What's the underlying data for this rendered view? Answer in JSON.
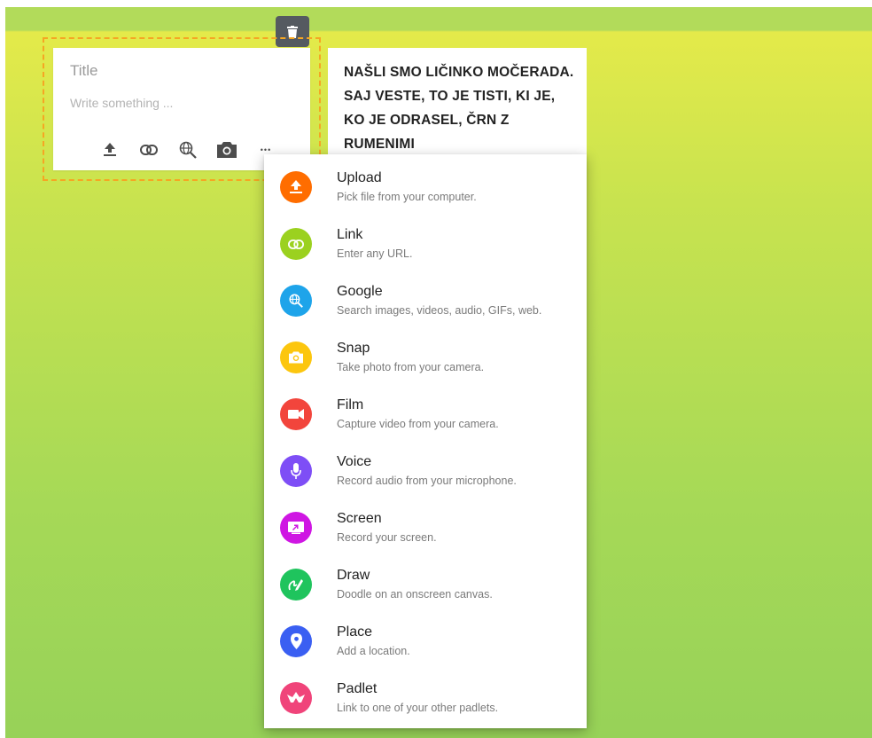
{
  "composer": {
    "title_placeholder": "Title",
    "body_placeholder": "Write something ..."
  },
  "toolbar": {
    "tools": [
      {
        "icon": "upload-icon"
      },
      {
        "icon": "link-icon"
      },
      {
        "icon": "globe-search-icon"
      },
      {
        "icon": "camera-icon"
      },
      {
        "icon": "more-icon",
        "glyph": "•••"
      }
    ]
  },
  "note": {
    "text": "NAŠLI SMO LIČINKO MOČERADA. SAJ VESTE, TO JE TISTI, KI JE, KO JE ODRASEL, ČRN Z RUMENIMI"
  },
  "menu": {
    "items": [
      {
        "label": "Upload",
        "desc": "Pick file from your computer.",
        "color": "#ff6d00",
        "icon": "upload-icon"
      },
      {
        "label": "Link",
        "desc": "Enter any URL.",
        "color": "#9bd11f",
        "icon": "link-icon"
      },
      {
        "label": "Google",
        "desc": "Search images, videos, audio, GIFs, web.",
        "color": "#1ea4ea",
        "icon": "google-search-icon"
      },
      {
        "label": "Snap",
        "desc": "Take photo from your camera.",
        "color": "#fcc60e",
        "icon": "camera-icon"
      },
      {
        "label": "Film",
        "desc": "Capture video from your camera.",
        "color": "#f2453c",
        "icon": "video-camera-icon"
      },
      {
        "label": "Voice",
        "desc": "Record audio from your microphone.",
        "color": "#7e4ef6",
        "icon": "microphone-icon"
      },
      {
        "label": "Screen",
        "desc": "Record your screen.",
        "color": "#cf16e3",
        "icon": "screen-record-icon"
      },
      {
        "label": "Draw",
        "desc": "Doodle on an onscreen canvas.",
        "color": "#1fc45d",
        "icon": "draw-icon"
      },
      {
        "label": "Place",
        "desc": "Add a location.",
        "color": "#3a5ff2",
        "icon": "location-pin-icon"
      },
      {
        "label": "Padlet",
        "desc": "Link to one of your other padlets.",
        "color": "#f0447a",
        "icon": "padlet-icon"
      }
    ]
  }
}
